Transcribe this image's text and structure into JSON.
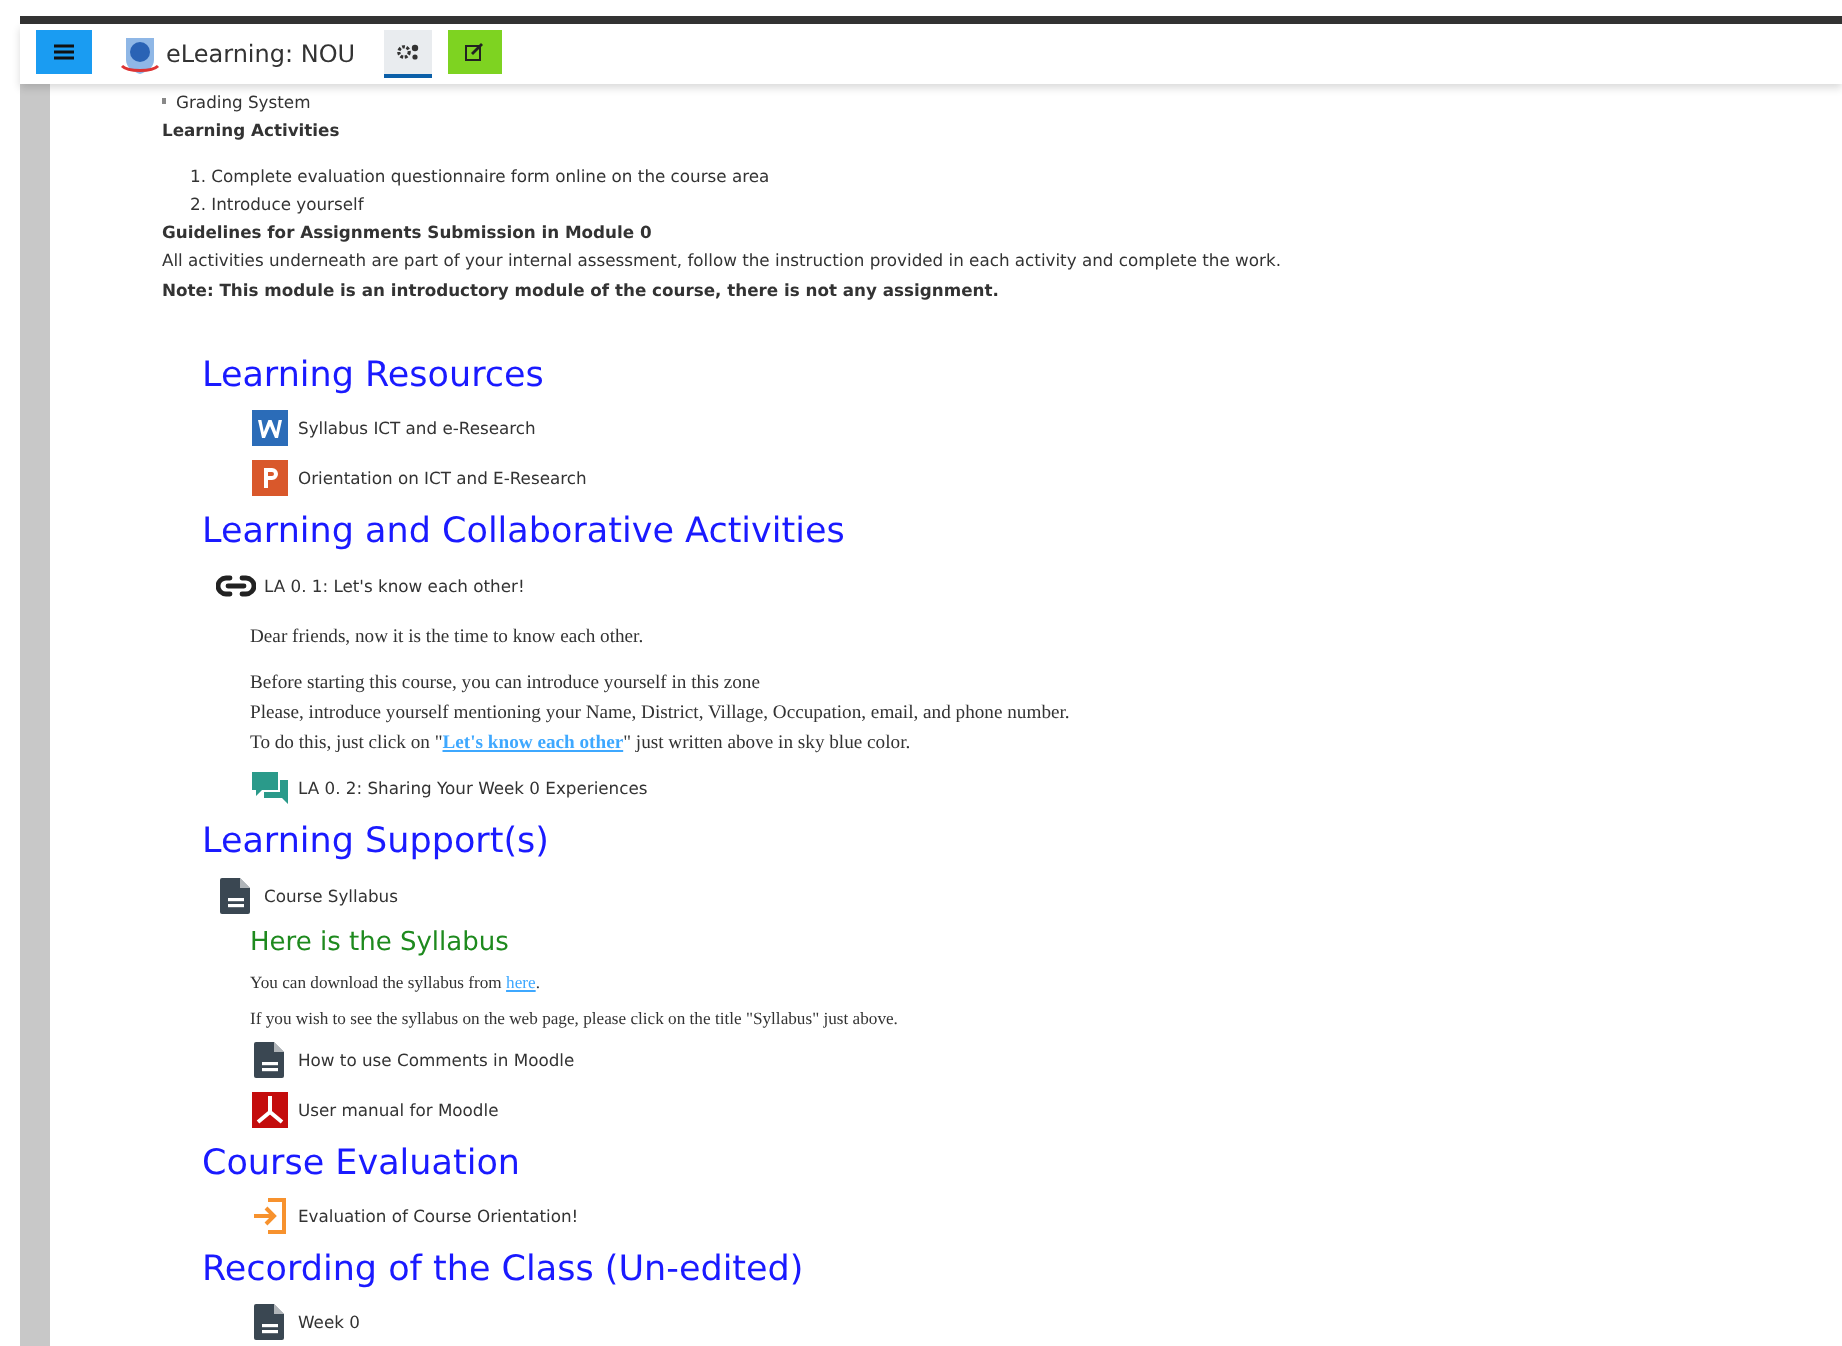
{
  "navbar": {
    "site_name": "eLearning: NOU",
    "buttons": [
      {
        "kind": "menu",
        "selected": false
      },
      {
        "kind": "settings",
        "selected": true
      },
      {
        "kind": "edit",
        "selected": false
      }
    ]
  },
  "intro": {
    "bullets": [
      "Grading System"
    ],
    "activities_heading": "Learning Activities",
    "steps": [
      "1. Complete evaluation questionnaire form online on the course area",
      "2. Introduce yourself"
    ],
    "guidelines_heading": "Guidelines for Assignments Submission in Module 0",
    "guidelines_text": "All activities underneath are part of your internal assessment, follow the instruction provided in each activity and complete the work.",
    "note": "Note: This module is an introductory module of the course, there is not any assignment."
  },
  "sections": [
    {
      "title": "Learning Resources",
      "items": [
        {
          "kind": "word",
          "label": "Syllabus ICT and e-Research"
        },
        {
          "kind": "powerpoint",
          "label": "Orientation on ICT and E-Research"
        }
      ]
    },
    {
      "title": "Learning and Collaborative Activities",
      "items": [
        {
          "kind": "url",
          "label": "LA 0. 1: Let's know each other!",
          "description": {
            "paragraphs": [
              {
                "lines": [
                  {
                    "text": "Dear friends, now it is the time to know each other."
                  }
                ]
              },
              {
                "lines": [
                  {
                    "text": "Before starting this course, you can introduce yourself in this zone"
                  },
                  {
                    "text": "Please, introduce yourself mentioning your Name, District, Village, Occupation, email, and phone number."
                  },
                  {
                    "text": "To do this, just click on \"",
                    "link": "Let's know each other",
                    "after": "\" just written above in sky blue color."
                  }
                ]
              }
            ]
          }
        },
        {
          "kind": "forum",
          "label": "LA 0. 2: Sharing Your Week 0 Experiences"
        }
      ]
    },
    {
      "title": "Learning Support(s)",
      "items": [
        {
          "kind": "file",
          "label": "Course Syllabus",
          "description": {
            "heading": "Here is the Syllabus",
            "paragraphs": [
              {
                "lines": [
                  {
                    "text": "You can download the syllabus from ",
                    "link": "here",
                    "after": "."
                  }
                ]
              },
              {
                "lines": [
                  {
                    "text": "If you wish to see the syllabus on the web page, please click on the title \"Syllabus\" just above."
                  }
                ]
              }
            ]
          }
        },
        {
          "kind": "file",
          "label": "How to use Comments in Moodle"
        },
        {
          "kind": "pdf",
          "label": "User manual for Moodle"
        }
      ]
    },
    {
      "title": "Course Evaluation",
      "items": [
        {
          "kind": "feedback",
          "label": "Evaluation of Course Orientation!"
        }
      ]
    },
    {
      "title": "Recording of the Class (Un-edited)",
      "items": [
        {
          "kind": "file",
          "label": "Week 0"
        }
      ]
    }
  ]
}
